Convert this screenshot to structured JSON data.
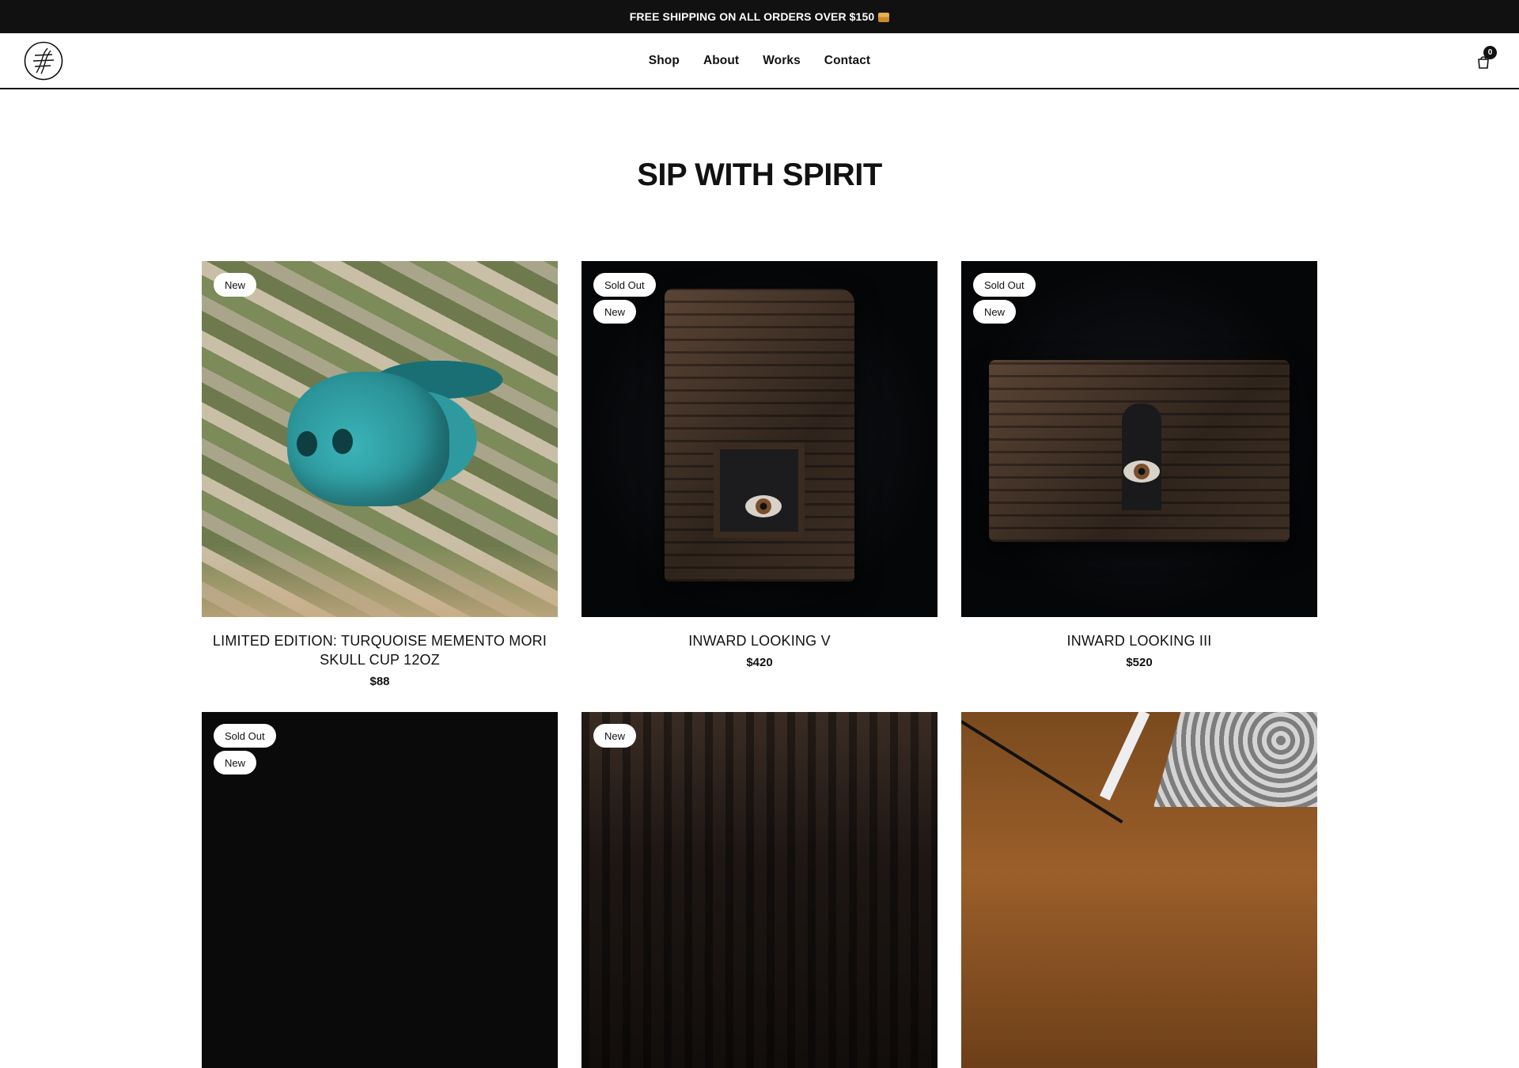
{
  "announcement": {
    "text": "FREE SHIPPING ON ALL ORDERS OVER $150",
    "icon": "package-icon"
  },
  "header": {
    "logo": "brand-logo",
    "nav": [
      {
        "label": "Shop"
      },
      {
        "label": "About"
      },
      {
        "label": "Works"
      },
      {
        "label": "Contact"
      }
    ],
    "cart": {
      "icon": "cart-icon",
      "count": "0"
    }
  },
  "page": {
    "title": "SIP WITH SPIRIT"
  },
  "products": [
    {
      "badges": [
        "New"
      ],
      "title": "LIMITED EDITION: TURQUOISE MEMENTO MORI SKULL CUP 12OZ",
      "price": "$88"
    },
    {
      "badges": [
        "Sold Out",
        "New"
      ],
      "title": "INWARD LOOKING V",
      "price": "$420"
    },
    {
      "badges": [
        "Sold Out",
        "New"
      ],
      "title": "INWARD LOOKING III",
      "price": "$520"
    },
    {
      "badges": [
        "Sold Out",
        "New"
      ],
      "title": "",
      "price": ""
    },
    {
      "badges": [
        "New"
      ],
      "title": "",
      "price": ""
    },
    {
      "badges": [],
      "title": "",
      "price": ""
    }
  ],
  "colors": {
    "topbar": "#111111",
    "text": "#111111",
    "badge_bg": "#ffffff"
  }
}
